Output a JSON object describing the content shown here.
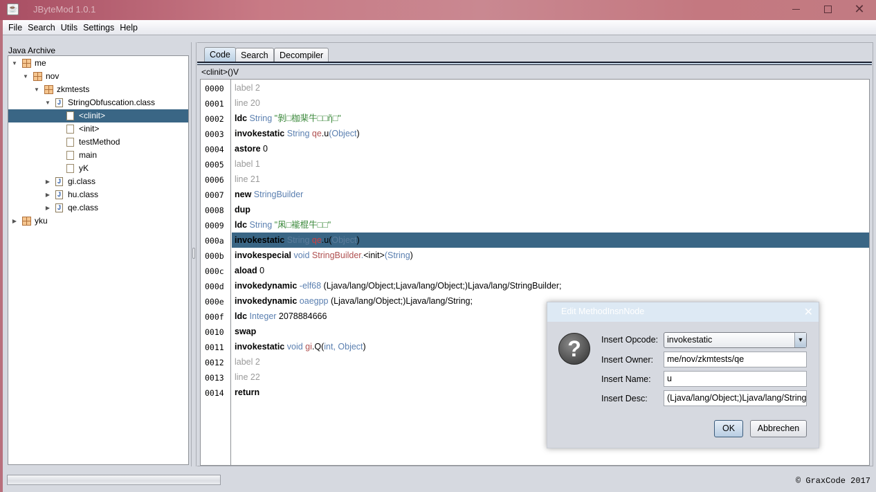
{
  "window": {
    "title": "JByteMod 1.0.1",
    "controls": {
      "minimize": "–",
      "maximize": "□",
      "close": "✕"
    }
  },
  "menu": [
    "File",
    "Search",
    "Utils",
    "Settings",
    "Help"
  ],
  "left_panel": {
    "label": "Java Archive",
    "tree": [
      {
        "label": "me",
        "type": "package",
        "depth": 0,
        "expanded": true
      },
      {
        "label": "nov",
        "type": "package",
        "depth": 1,
        "expanded": true
      },
      {
        "label": "zkmtests",
        "type": "package",
        "depth": 2,
        "expanded": true
      },
      {
        "label": "StringObfuscation.class",
        "type": "class",
        "depth": 3,
        "expanded": true
      },
      {
        "label": "<clinit>",
        "type": "method",
        "depth": 4,
        "selected": true
      },
      {
        "label": "<init>",
        "type": "method",
        "depth": 4
      },
      {
        "label": "testMethod",
        "type": "method",
        "depth": 4
      },
      {
        "label": "main",
        "type": "method",
        "depth": 4
      },
      {
        "label": "yK",
        "type": "method",
        "depth": 4
      },
      {
        "label": "gi.class",
        "type": "class",
        "depth": 3,
        "expanded": false
      },
      {
        "label": "hu.class",
        "type": "class",
        "depth": 3,
        "expanded": false
      },
      {
        "label": "qe.class",
        "type": "class",
        "depth": 3,
        "expanded": false
      },
      {
        "label": "yku",
        "type": "package",
        "depth": 0,
        "expanded": false
      }
    ]
  },
  "right_panel": {
    "tabs": [
      {
        "label": "Code",
        "active": true
      },
      {
        "label": "Search"
      },
      {
        "label": "Decompiler"
      }
    ],
    "method_signature": "<clinit>()V",
    "code": [
      {
        "num": "0000",
        "parts": [
          [
            "muted",
            "label 2"
          ]
        ]
      },
      {
        "num": "0001",
        "parts": [
          [
            "muted",
            "line 20"
          ]
        ]
      },
      {
        "num": "0002",
        "parts": [
          [
            "op",
            "ldc"
          ],
          [
            "type",
            " String "
          ],
          [
            "str",
            "\"剝□枷棐牛□□ῆ□\""
          ]
        ]
      },
      {
        "num": "0003",
        "parts": [
          [
            "op",
            "invokestatic"
          ],
          [
            "type",
            " String "
          ],
          [
            "owner",
            "qe"
          ],
          [
            "plain",
            ".u"
          ],
          [
            "type",
            "(Object"
          ],
          [
            "plain",
            ")"
          ]
        ]
      },
      {
        "num": "0004",
        "parts": [
          [
            "op",
            "astore"
          ],
          [
            "plain",
            " 0"
          ]
        ]
      },
      {
        "num": "0005",
        "parts": [
          [
            "muted",
            "label 1"
          ]
        ]
      },
      {
        "num": "0006",
        "parts": [
          [
            "muted",
            "line 21"
          ]
        ]
      },
      {
        "num": "0007",
        "parts": [
          [
            "op",
            "new"
          ],
          [
            "type",
            " StringBuilder"
          ]
        ]
      },
      {
        "num": "0008",
        "parts": [
          [
            "op",
            "dup"
          ]
        ]
      },
      {
        "num": "0009",
        "parts": [
          [
            "op",
            "ldc"
          ],
          [
            "type",
            " String "
          ],
          [
            "str",
            "\"凩□褦棍牛□□\""
          ]
        ]
      },
      {
        "num": "000a",
        "selected": true,
        "parts": [
          [
            "op",
            "invokestatic"
          ],
          [
            "type",
            " String "
          ],
          [
            "owner",
            "qe"
          ],
          [
            "plain",
            ".u("
          ],
          [
            "type",
            "Object"
          ],
          [
            "plain",
            ")"
          ]
        ]
      },
      {
        "num": "000b",
        "parts": [
          [
            "op",
            "invokespecial"
          ],
          [
            "type",
            " void "
          ],
          [
            "owner",
            "StringBuilder"
          ],
          [
            "type",
            "."
          ],
          [
            "plain",
            "<init>"
          ],
          [
            "type",
            "(String"
          ],
          [
            "plain",
            ")"
          ]
        ]
      },
      {
        "num": "000c",
        "parts": [
          [
            "op",
            "aload"
          ],
          [
            "plain",
            " 0"
          ]
        ]
      },
      {
        "num": "000d",
        "parts": [
          [
            "op",
            "invokedynamic"
          ],
          [
            "type",
            " -elf68"
          ],
          [
            "plain",
            " (Ljava/lang/Object;Ljava/lang/Object;)Ljava/lang/StringBuilder;"
          ]
        ]
      },
      {
        "num": "000e",
        "parts": [
          [
            "op",
            "invokedynamic"
          ],
          [
            "type",
            " oaegpp"
          ],
          [
            "plain",
            " (Ljava/lang/Object;)Ljava/lang/String;"
          ]
        ]
      },
      {
        "num": "000f",
        "parts": [
          [
            "op",
            "ldc"
          ],
          [
            "type",
            " Integer"
          ],
          [
            "plain",
            " 2078884666"
          ]
        ]
      },
      {
        "num": "0010",
        "parts": [
          [
            "op",
            "swap"
          ]
        ]
      },
      {
        "num": "0011",
        "parts": [
          [
            "op",
            "invokestatic"
          ],
          [
            "type",
            " void "
          ],
          [
            "owner",
            "gi"
          ],
          [
            "plain",
            ".Q("
          ],
          [
            "type",
            "int, Object"
          ],
          [
            "plain",
            ")"
          ]
        ]
      },
      {
        "num": "0012",
        "parts": [
          [
            "muted",
            "label 2"
          ]
        ]
      },
      {
        "num": "0013",
        "parts": [
          [
            "muted",
            "line 22"
          ]
        ]
      },
      {
        "num": "0014",
        "parts": [
          [
            "op",
            "return"
          ]
        ]
      }
    ]
  },
  "status": {
    "progress": 0,
    "copyright": "© GraxCode 2017"
  },
  "dialog": {
    "title": "Edit MethodInsnNode",
    "close": "✕",
    "icon": "?",
    "fields": {
      "opcode_label": "Insert Opcode:",
      "opcode_value": "invokestatic",
      "owner_label": "Insert Owner:",
      "owner_value": "me/nov/zkmtests/qe",
      "name_label": "Insert Name:",
      "name_value": "u",
      "desc_label": "Insert Desc:",
      "desc_value": "(Ljava/lang/Object;)Ljava/lang/String;"
    },
    "ok_label": "OK",
    "cancel_label": "Abbrechen",
    "dropdown_arrow": "▼"
  }
}
